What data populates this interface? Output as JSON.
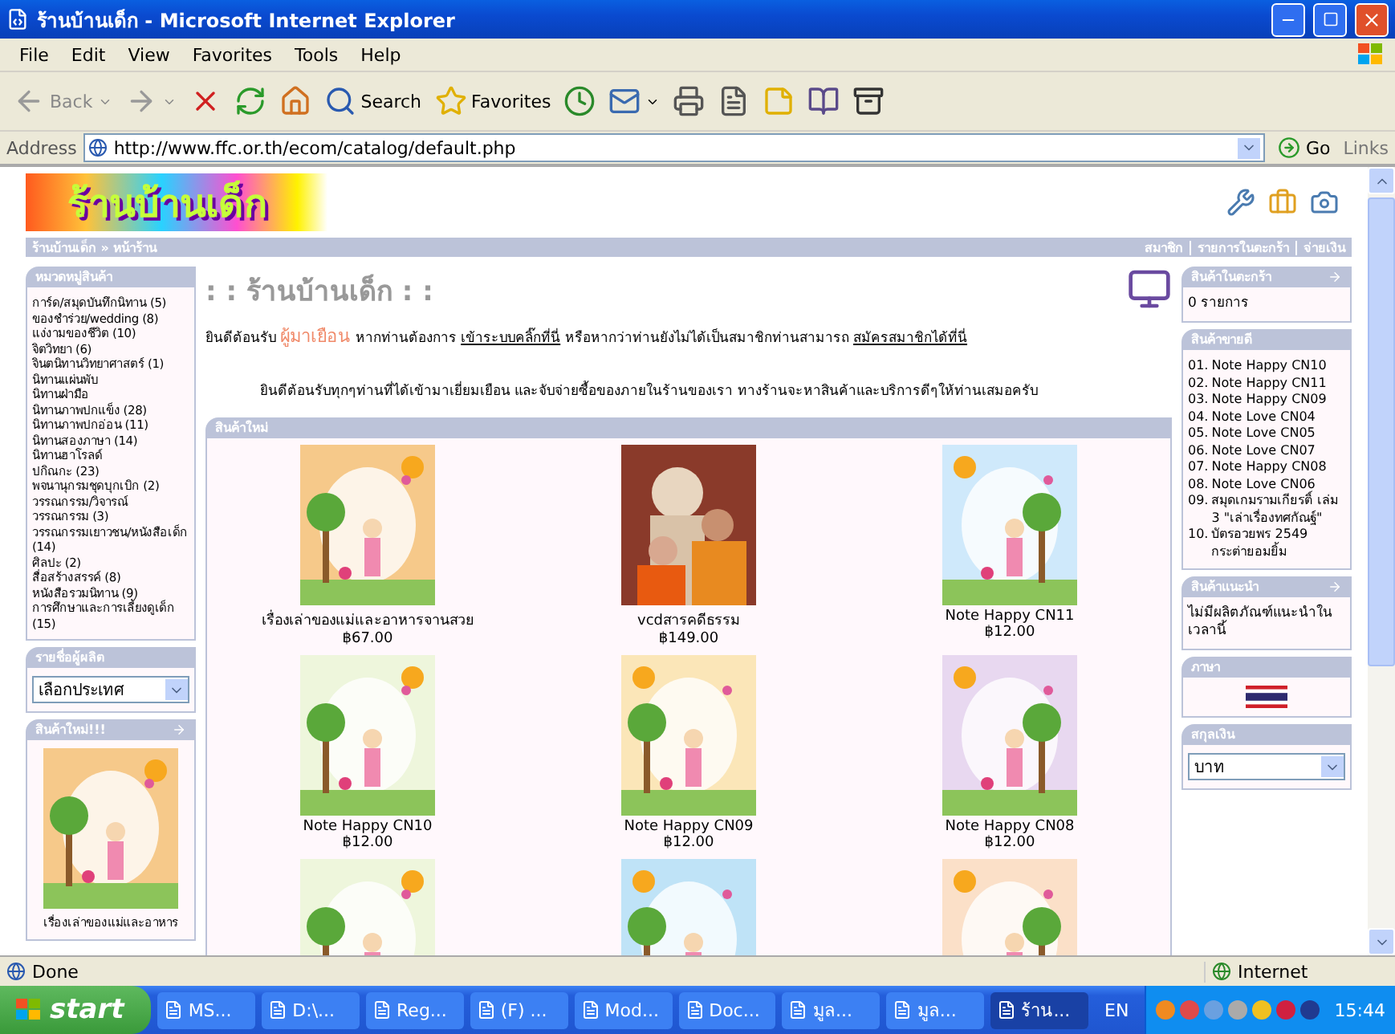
{
  "window": {
    "title": "ร้านบ้านเด็ก - Microsoft Internet Explorer"
  },
  "menu": [
    "File",
    "Edit",
    "View",
    "Favorites",
    "Tools",
    "Help"
  ],
  "toolbar": [
    {
      "kind": "back",
      "label": "Back",
      "dropdown": true,
      "disabled": true
    },
    {
      "kind": "forward",
      "dropdown": true,
      "disabled": true
    },
    {
      "kind": "stop",
      "dropdown": false,
      "disabled": false
    },
    {
      "kind": "refresh",
      "dropdown": false,
      "disabled": false
    },
    {
      "kind": "home",
      "dropdown": false,
      "disabled": false
    },
    {
      "kind": "search",
      "label": "Search",
      "dropdown": false,
      "disabled": false
    },
    {
      "kind": "favorites",
      "label": "Favorites",
      "dropdown": false,
      "disabled": false
    },
    {
      "kind": "history",
      "dropdown": false,
      "disabled": false
    },
    {
      "kind": "mail",
      "dropdown": true,
      "disabled": false
    },
    {
      "kind": "print",
      "dropdown": false,
      "disabled": false
    },
    {
      "kind": "edit",
      "dropdown": false,
      "disabled": false
    },
    {
      "kind": "note",
      "dropdown": false,
      "disabled": false
    },
    {
      "kind": "research",
      "dropdown": false,
      "disabled": false
    },
    {
      "kind": "archive",
      "dropdown": false,
      "disabled": false
    }
  ],
  "address": {
    "label": "Address",
    "url": "http://www.ffc.or.th/ecom/catalog/default.php",
    "go": "Go",
    "links": "Links"
  },
  "site": {
    "logo": "ร้านบ้านเด็ก",
    "breadcrumb": "ร้านบ้านเด็ก » หน้าร้าน",
    "header_links": [
      "สมาชิก",
      "รายการในตะกร้า",
      "จ่ายเงิน"
    ],
    "categories": {
      "title": "หมวดหมู่สินค้า",
      "items": [
        "การ์ด/สมุดบันทึกนิทาน (5)",
        "ของชำร่วย/wedding (8)",
        "แง่งามของชีวิต (10)",
        "จิตวิทยา (6)",
        "จินตนิทานวิทยาศาสตร์ (1)",
        "นิทานแผ่นพับ",
        "นิทานฝ่ามือ",
        "นิทานภาพปกแข็ง (28)",
        "นิทานภาพปกอ่อน (11)",
        "นิทานสองภาษา (14)",
        "นิทานฮาโรลด์",
        "ปกิณกะ (23)",
        "พจนานุกรมชุดบุกเบิก (2)",
        "วรรณกรรม/วิจารณ์",
        "วรรณกรรม (3)",
        "วรรณกรรมเยาวชน/หนังสือเด็ก (14)",
        "ศิลปะ (2)",
        "สื่อสร้างสรรค์ (8)",
        "หนังสือรวมนิทาน (9)",
        "การศึกษาและการเลี้ยงดูเด็ก (15)"
      ]
    },
    "manufacturers": {
      "title": "รายชื่อผู้ผลิต",
      "value": "เลือกประเทศ"
    },
    "whats_new": {
      "title": "สินค้าใหม่!!!",
      "caption": "เรื่องเล่าของแม่และอาหาร"
    },
    "heading": ": : ร้านบ้านเด็ก : :",
    "welcome": [
      {
        "kind": "text",
        "text": "ยินดีต้อนรับ "
      },
      {
        "kind": "highlight",
        "text": "ผู้มาเยือน"
      },
      {
        "kind": "text",
        "text": " หากท่านต้องการ "
      },
      {
        "kind": "link",
        "text": "เข้าระบบคลิ๊กที่นี่"
      },
      {
        "kind": "text",
        "text": " หรือหากว่าท่านยังไม่ได้เป็นสมาชิกท่านสามารถ "
      },
      {
        "kind": "link",
        "text": "สมัครสมาชิกได้ที่นี่"
      }
    ],
    "intro": "ยินดีต้อนรับทุกๆท่านที่ได้เข้ามาเยี่ยมเยือน และจับจ่ายซื้อของภายในร้านของเรา ทางร้านจะหาสินค้าและบริการดีๆให้ท่านเสมอครับ",
    "new_products": {
      "title": "สินค้าใหม่",
      "items": [
        {
          "kind": "product",
          "name": "เรื่องเล่าของแม่และอาหารจานสวย",
          "price": "฿67.00"
        },
        {
          "kind": "product",
          "name": "vcdสารคดีธรรม",
          "price": "฿149.00"
        },
        {
          "kind": "product",
          "name": "Note Happy CN11",
          "price": "฿12.00"
        },
        {
          "kind": "product",
          "name": "Note Happy CN10",
          "price": "฿12.00"
        },
        {
          "kind": "product",
          "name": "Note Happy CN09",
          "price": "฿12.00"
        },
        {
          "kind": "product",
          "name": "Note Happy CN08",
          "price": "฿12.00"
        },
        {
          "kind": "picture"
        },
        {
          "kind": "picture"
        },
        {
          "kind": "picture"
        }
      ]
    },
    "cart": {
      "title": "สินค้าในตะกร้า",
      "text": "0 รายการ"
    },
    "bestsellers": {
      "title": "สินค้าขายดี",
      "items": [
        {
          "number": "01.",
          "name": "Note Happy CN10"
        },
        {
          "number": "02.",
          "name": "Note Happy CN11"
        },
        {
          "number": "03.",
          "name": "Note Happy CN09"
        },
        {
          "number": "04.",
          "name": "Note Love CN04"
        },
        {
          "number": "05.",
          "name": "Note Love CN05"
        },
        {
          "number": "06.",
          "name": "Note Love CN07"
        },
        {
          "number": "07.",
          "name": "Note Happy CN08"
        },
        {
          "number": "08.",
          "name": "Note Love CN06"
        },
        {
          "number": "09.",
          "name": "สมุดเกมรามเกียรติ์ เล่ม 3 \"เล่าเรื่องทศกัณฐ์\""
        },
        {
          "number": "10.",
          "name": "บัตรอวยพร 2549 กระต่ายอมยิ้ม"
        }
      ]
    },
    "specials": {
      "title": "สินค้าแนะนำ",
      "text": "ไม่มีผลิตภัณฑ์แนะนำในเวลานี้"
    },
    "languages": {
      "title": "ภาษา"
    },
    "currencies": {
      "title": "สกุลเงิน",
      "value": "บาท"
    }
  },
  "status": {
    "text": "Done",
    "zone": "Internet"
  },
  "taskbar": {
    "start": "start",
    "items": [
      {
        "label": "MS...",
        "selected": false
      },
      {
        "label": "D:\\...",
        "selected": false
      },
      {
        "label": "Reg...",
        "selected": false
      },
      {
        "label": "(F) ...",
        "selected": false
      },
      {
        "label": "Mod...",
        "selected": false
      },
      {
        "label": "Doc...",
        "selected": false
      },
      {
        "label": "มูล...",
        "selected": false
      },
      {
        "label": "มูล...",
        "selected": false
      },
      {
        "label": "ร้าน...",
        "selected": true
      }
    ],
    "language": "EN",
    "clock": "15:44"
  }
}
